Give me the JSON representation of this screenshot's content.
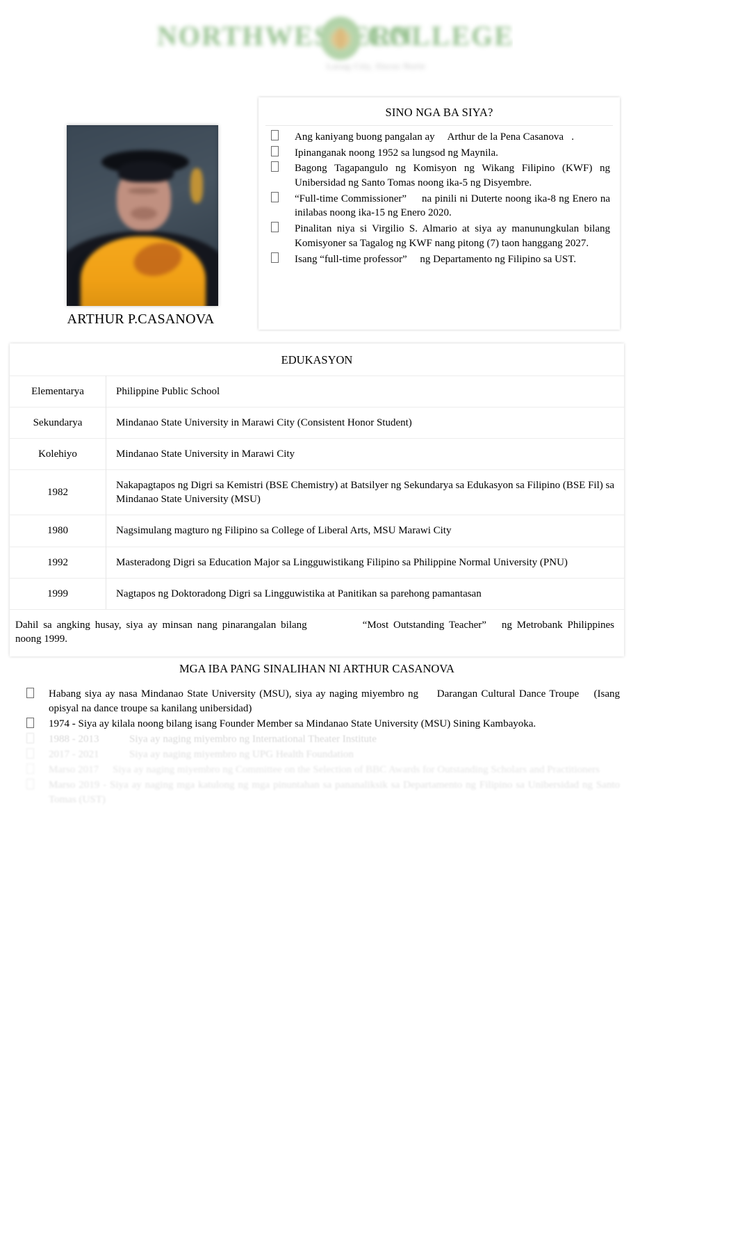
{
  "header": {
    "logo_left": "NORTHWESTERN",
    "logo_right": "COLLEGE",
    "logo_subtitle": "Laoag City, Ilocos Norte"
  },
  "profile": {
    "photo_alt": "graduation-portrait",
    "name": "ARTHUR P.CASANOVA"
  },
  "sino": {
    "title": "SINO NGA BA SIYA?",
    "bullets": [
      "Ang kaniyang buong pangalan ay     Arthur de la Pena Casanova   .",
      "Ipinanganak noong 1952 sa lungsod ng Maynila.",
      "Bagong Tagapangulo ng Komisyon ng Wikang Filipino (KWF) ng Unibersidad ng Santo Tomas noong ika-5 ng Disyembre.",
      "“Full-time Commissioner”     na pinili ni Duterte noong ika-8 ng Enero na inilabas noong ika-15 ng Enero 2020.",
      "Pinalitan niya si Virgilio S. Almario at siya ay manunungkulan bilang Komisyoner sa Tagalog ng KWF nang pitong (7) taon hanggang 2027.",
      "Isang “full-time professor”     ng Departamento ng Filipino sa UST."
    ]
  },
  "edukasyon": {
    "title": "EDUKASYON",
    "rows": [
      {
        "key": "Elementarya",
        "value": "Philippine Public School"
      },
      {
        "key": "Sekundarya",
        "value": "Mindanao State University in Marawi City (Consistent Honor Student)"
      },
      {
        "key": "Kolehiyo",
        "value": "Mindanao State University in Marawi City"
      },
      {
        "key": "1982",
        "value": "Nakapagtapos ng Digri sa Kemistri (BSE Chemistry) at Batsilyer ng Sekundarya sa Edukasyon sa Filipino (BSE Fil) sa Mindanao State University (MSU)"
      },
      {
        "key": "1980",
        "value": "Nagsimulang magturo ng Filipino sa College of Liberal Arts, MSU Marawi City"
      },
      {
        "key": "1992",
        "value": "Masteradong Digri sa Education Major sa Lingguwistikang Filipino sa Philippine Normal University (PNU)"
      },
      {
        "key": "1999",
        "value": "Nagtapos ng Doktoradong Digri sa Lingguwistika at Panitikan sa parehong pamantasan"
      }
    ],
    "note_part1": "Dahil sa angking husay, siya ay minsan nang pinarangalan bilang",
    "note_award": "“Most Outstanding Teacher”",
    "note_part2": "ng Metrobank Philippines noong 1999."
  },
  "other": {
    "title": "MGA IBA PANG SINALIHAN NI ARTHUR CASANOVA",
    "bullets": [
      "Habang siya ay nasa Mindanao State University (MSU), siya ay naging miyembro ng     Darangan Cultural Dance Troupe    (Isang opisyal na dance troupe sa kanilang unibersidad)",
      "1974 - Siya ay kilala noong bilang isang Founder Member sa Mindanao State University (MSU) Sining Kambayoka."
    ],
    "faded_rows": [
      {
        "years": "1988 - 2013",
        "text": "Siya ay naging miyembro ng International Theater Institute"
      },
      {
        "years": "2017 - 2021",
        "text": "Siya ay naging miyembro ng UPG Health Foundation"
      },
      {
        "years": "Marso 2017",
        "text": "Siya ay naging miyembro ng Committee on the Selection of BBC Awards for Outstanding Scholars and Practitioners"
      }
    ],
    "faded_last": "Marso 2019 - Siya ay naging mga katulong ng mga pinuntahan sa pananaliksik sa Departamento ng Filipino sa Unibersidad ng Santo Tomas (UST)"
  }
}
